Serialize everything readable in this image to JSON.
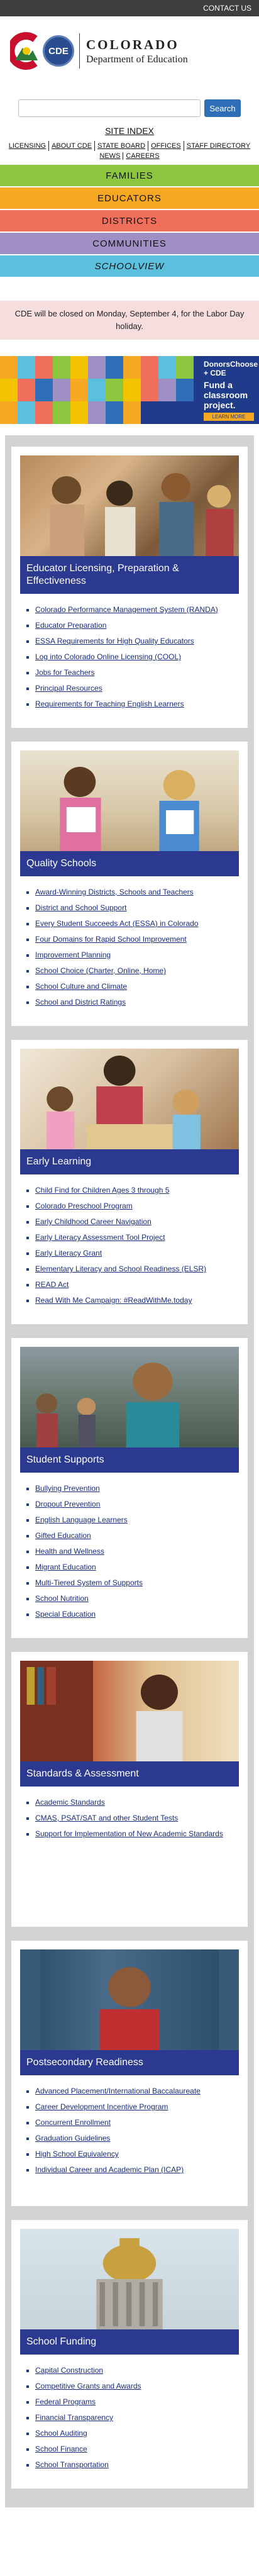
{
  "topbar": {
    "contact": "CONTACT US"
  },
  "header": {
    "brand_line1": "COLORADO",
    "brand_line2": "Department of Education",
    "seal_text": "CDE"
  },
  "search": {
    "placeholder": "",
    "button": "Search"
  },
  "site_index": "SITE INDEX",
  "top_links": [
    "LICENSING",
    "ABOUT CDE",
    "STATE BOARD",
    "OFFICES",
    "STAFF DIRECTORY"
  ],
  "top_links2": [
    "NEWS",
    "CAREERS"
  ],
  "nav": {
    "families": "FAMILIES",
    "educators": "EDUCATORS",
    "districts": "DISTRICTS",
    "communities": "COMMUNITIES",
    "schoolview": "SCHOOLVIEW"
  },
  "alert": "CDE will be closed on Monday, September 4, for the Labor Day holiday.",
  "banner": {
    "brand": "DonorsChoose + CDE",
    "headline": "Fund a classroom project.",
    "cta": "LEARN MORE"
  },
  "cards": [
    {
      "title": "Educator Licensing, Preparation & Effectiveness",
      "photo": "educators-group-photo",
      "links": [
        "Colorado Performance Management System (RANDA)",
        "Educator Preparation",
        "ESSA Requirements for High Quality Educators",
        "Log into Colorado Online Licensing (COOL)",
        "Jobs for Teachers",
        "Principal Resources",
        "Requirements for Teaching English Learners"
      ]
    },
    {
      "title": "Quality Schools",
      "photo": "students-with-papers-photo",
      "links": [
        "Award-Winning Districts, Schools and Teachers",
        "District and School Support",
        "Every Student Succeeds Act (ESSA) in Colorado",
        "Four Domains for Rapid School Improvement",
        "Improvement Planning",
        "School Choice (Charter, Online, Home)",
        "School Culture and Climate",
        "School and District Ratings"
      ]
    },
    {
      "title": "Early Learning",
      "photo": "teacher-and-children-photo",
      "links": [
        "Child Find for Children Ages 3 through 5",
        "Colorado Preschool Program",
        "Early Childhood Career Navigation",
        "Early Literacy Assessment Tool Project",
        "Early Literacy Grant",
        "Elementary Literacy and School Readiness (ELSR)",
        "READ Act",
        "Read With Me Campaign: #ReadWithMe.today"
      ]
    },
    {
      "title": "Student Supports",
      "photo": "smiling-student-photo",
      "links": [
        "Bullying Prevention",
        "Dropout Prevention",
        "English Language Learners",
        "Gifted Education",
        "Health and Wellness",
        "Migrant Education",
        "Multi-Tiered System of Supports",
        "School Nutrition",
        "Special Education"
      ]
    },
    {
      "title": "Standards & Assessment",
      "photo": "child-with-books-photo",
      "links": [
        "Academic Standards",
        "CMAS, PSAT/SAT and other Student Tests",
        "Support for Implementation of New Academic Standards"
      ]
    },
    {
      "title": "Postsecondary Readiness",
      "photo": "high-school-student-photo",
      "links": [
        "Advanced Placement/International Baccalaureate",
        "Career Development Incentive Program",
        "Concurrent Enrollment",
        "Graduation Guidelines",
        "High School Equivalency",
        "Individual Career and Academic Plan (ICAP)"
      ]
    },
    {
      "title": "School Funding",
      "photo": "capitol-dome-photo",
      "links": [
        "Capital Construction",
        "Competitive Grants and Awards",
        "Federal Programs",
        "Financial Transparency",
        "School Auditing",
        "School Finance",
        "School Transportation"
      ]
    }
  ],
  "colors": {
    "topbar": "#3e3e3e",
    "card_title": "#2b3990",
    "families": "#8cc63f",
    "educators": "#f7a823",
    "districts": "#ef6f5a",
    "communities": "#a08fc4",
    "schoolview": "#5bc0de",
    "alert_bg": "#f6dede"
  }
}
